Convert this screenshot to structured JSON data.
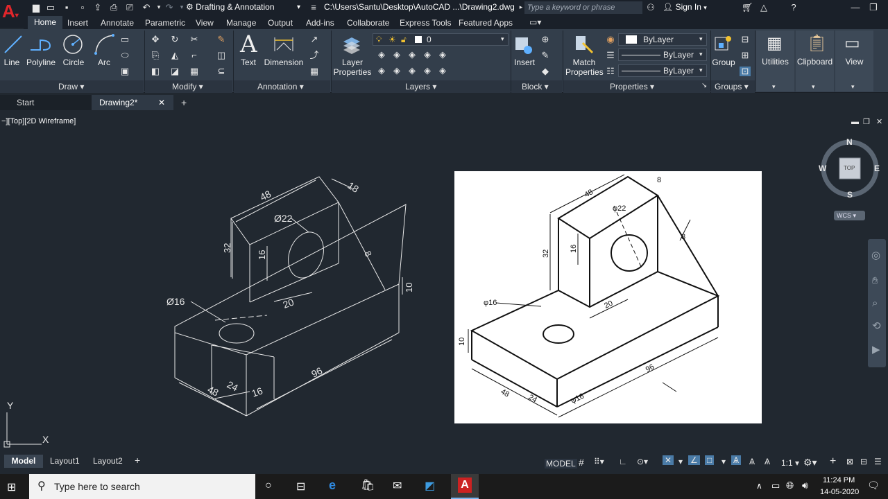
{
  "titlebar": {
    "workspace": "Drafting & Annotation",
    "document_path": "C:\\Users\\Santu\\Desktop\\AutoCAD ...\\Drawing2.dwg",
    "search_placeholder": "Type a keyword or phrase",
    "signin": "Sign In"
  },
  "ribbon_tabs": [
    "Home",
    "Insert",
    "Annotate",
    "Parametric",
    "View",
    "Manage",
    "Output",
    "Add-ins",
    "Collaborate",
    "Express Tools",
    "Featured Apps"
  ],
  "draw_panel": {
    "title": "Draw",
    "line": "Line",
    "polyline": "Polyline",
    "circle": "Circle",
    "arc": "Arc"
  },
  "modify_panel": {
    "title": "Modify"
  },
  "annotation_panel": {
    "title": "Annotation",
    "text": "Text",
    "dimension": "Dimension"
  },
  "layers_panel": {
    "title": "Layers",
    "layer_properties_1": "Layer",
    "layer_properties_2": "Properties",
    "current_layer": "0"
  },
  "block_panel": {
    "title": "Block",
    "insert": "Insert"
  },
  "properties_panel": {
    "title": "Properties",
    "match_1": "Match",
    "match_2": "Properties",
    "color": "ByLayer",
    "linetype": "ByLayer",
    "lineweight": "ByLayer"
  },
  "groups_panel": {
    "title": "Groups",
    "group": "Group"
  },
  "utilities": "Utilities",
  "clipboard": "Clipboard",
  "view_btn": "View",
  "file_tabs": {
    "start": "Start",
    "drawing": "Drawing2*"
  },
  "viewport": {
    "label": "−][Top][2D Wireframe]",
    "viewcube": {
      "n": "N",
      "s": "S",
      "e": "E",
      "w": "W",
      "top": "TOP",
      "wcs": "WCS"
    },
    "ucs": {
      "x": "X",
      "y": "Y"
    }
  },
  "drawing_dims": {
    "d48_top": "48",
    "d18": "18",
    "d22": "Ø22",
    "d32": "32",
    "d16_v": "16",
    "d8": "8",
    "d10": "10",
    "d20": "20",
    "d16_hole": "Ø16",
    "d96": "96",
    "d48_bottom": "48",
    "d24": "24",
    "d16_b": "16"
  },
  "reference_dims": {
    "d48_top": "48",
    "d8": "8",
    "d22": "φ22",
    "d32": "32",
    "d16": "16",
    "d8b": "8",
    "d20": "20",
    "d16_hole": "φ16",
    "d10": "10",
    "d96": "96",
    "d48_bottom": "48",
    "d24": "24",
    "d16_b": "φ16"
  },
  "layout_tabs": [
    "Model",
    "Layout1",
    "Layout2"
  ],
  "statusbar": {
    "model": "MODEL",
    "scale": "1:1"
  },
  "taskbar": {
    "search": "Type here to search",
    "time": "11:24 PM",
    "date": "14-05-2020"
  },
  "colors": {
    "accent_red": "#e0262b",
    "ribbon": "#333e4b",
    "canvas": "#212830"
  }
}
